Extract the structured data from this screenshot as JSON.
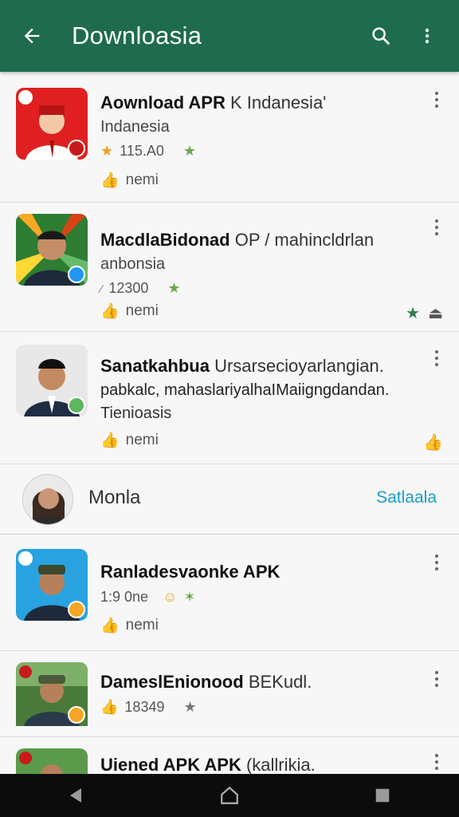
{
  "appbar": {
    "title": "Downloasia",
    "back_icon": "arrow-left-icon",
    "search_icon": "search-icon",
    "menu_icon": "more-vert-icon",
    "color": "#1f6b4e"
  },
  "items": [
    {
      "title_bold": "Aownload APR",
      "title_rest": "K Indanesia'",
      "subtitle": "Indanesia",
      "rating": "115.A0",
      "like_text": "nemi"
    },
    {
      "title_bold": "MacdlaBidonad",
      "title_rest": "OP / mahincldrlan",
      "subtitle": "anbonsia",
      "rating": "12300",
      "like_text": "nemi"
    },
    {
      "title_bold": "Sanatkahbua",
      "title_rest": "Ursarsecioyarlangian.",
      "subtitle": "pabkalc, mahaslariyalhaIMaiigngdandan.",
      "subtitle2": "Tienioasis",
      "like_text": "nemi"
    },
    {
      "title_bold": "Ranladesvaonke APK",
      "title_rest": "",
      "subtitle": "1:9 0ne",
      "like_text": "nemi"
    },
    {
      "title_bold": "DameslEnionood",
      "title_rest": "BEKudl.",
      "rating": "18349"
    },
    {
      "title_bold": "Uiened APK APK",
      "title_rest": "(kallrikia."
    }
  ],
  "profile": {
    "name": "Monla",
    "action": "Satlaala",
    "action_color": "#1a9dc9"
  },
  "navbar": {
    "back_icon": "nav-back-icon",
    "home_icon": "nav-home-icon",
    "recents_icon": "nav-recents-icon"
  }
}
